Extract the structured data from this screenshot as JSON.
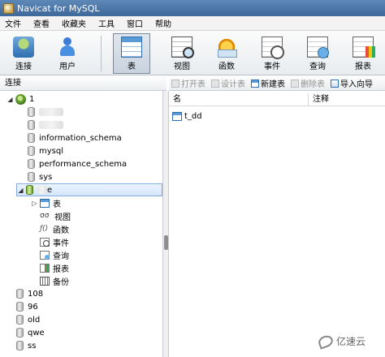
{
  "window": {
    "title": "Navicat for MySQL"
  },
  "menu": [
    "文件",
    "查看",
    "收藏夹",
    "工具",
    "窗口",
    "帮助"
  ],
  "toolbar": {
    "connect": "连接",
    "user": "用户",
    "table": "表",
    "view": "视图",
    "function": "函数",
    "event": "事件",
    "query": "查询",
    "report": "报表"
  },
  "left_panel": {
    "header": "连接",
    "tree": {
      "connection_name": "1",
      "databases": [
        "information_schema",
        "mysql",
        "performance_schema",
        "sys"
      ],
      "selected_db_suffix": "e",
      "children": [
        "表",
        "视图",
        "函数",
        "事件",
        "查询",
        "报表",
        "备份"
      ],
      "other_connections": [
        "108",
        "96",
        "old",
        "qwe",
        "ss"
      ]
    }
  },
  "right_panel": {
    "toolbar": {
      "open_table": "打开表",
      "design_table": "设计表",
      "new_table": "新建表",
      "delete_table": "删除表",
      "import_wizard": "导入向导"
    },
    "columns": {
      "name": "名",
      "comment": "注释"
    },
    "rows": [
      "t_dd"
    ]
  },
  "watermark": {
    "text": "亿速云"
  }
}
